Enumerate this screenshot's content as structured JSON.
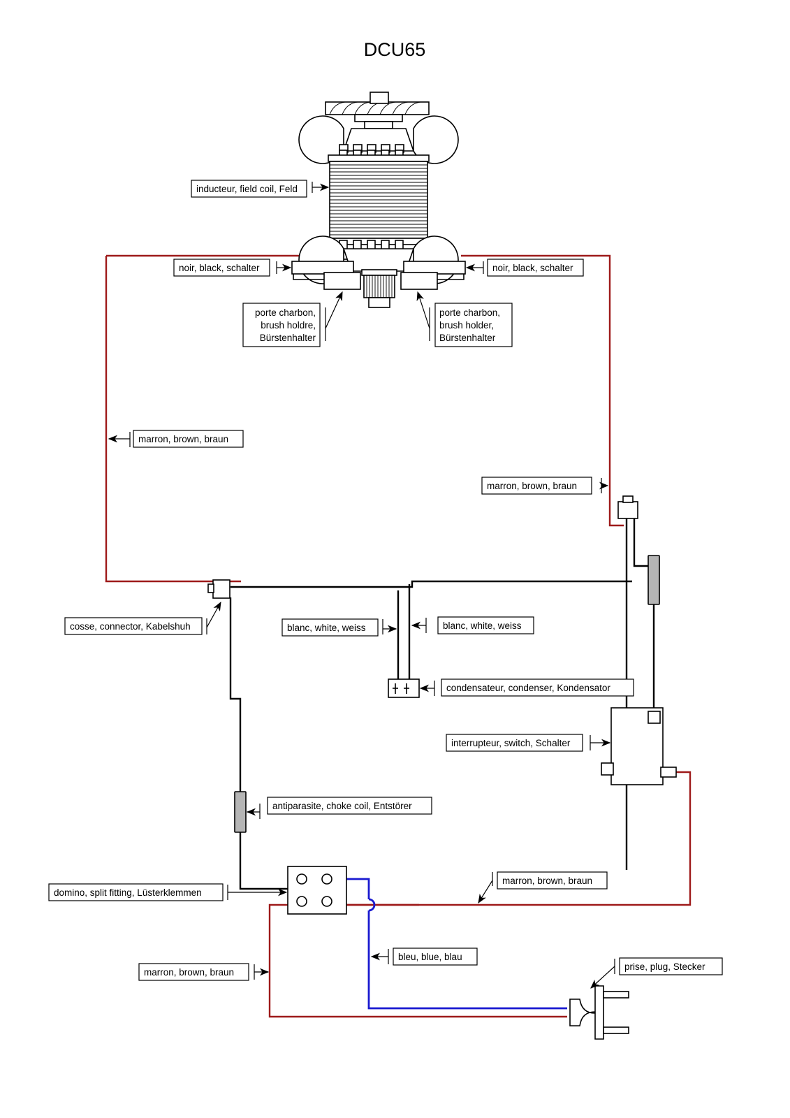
{
  "title": "DCU65",
  "labels": {
    "field_coil": "inducteur, field coil, Feld",
    "black_left": "noir, black, schalter",
    "black_right": "noir, black, schalter",
    "brush_left_line1": "porte charbon,",
    "brush_left_line2": "brush holdre,",
    "brush_left_line3": "Bürstenhalter",
    "brush_right_line1": "porte charbon,",
    "brush_right_line2": "brush holder,",
    "brush_right_line3": "Bürstenhalter",
    "brown_left": "marron, brown, braun",
    "brown_right": "marron, brown, braun",
    "connector": "cosse, connector, Kabelshuh",
    "white_left": "blanc, white, weiss",
    "white_right": "blanc, white, weiss",
    "condenser": "condensateur, condenser, Kondensator",
    "switch": "interrupteur, switch, Schalter",
    "choke": "antiparasite, choke coil, Entstörer",
    "domino": "domino, split fitting, Lüsterklemmen",
    "brown_mid": "marron, brown, braun",
    "brown_bottom": "marron, brown, braun",
    "blue": "bleu, blue, blau",
    "plug": "prise, plug, Stecker"
  },
  "colors": {
    "wire_brown": "#9e1a1a",
    "wire_blue": "#1a1ad0",
    "wire_black": "#000000",
    "part_gray": "#b5b5b5",
    "background": "#ffffff",
    "outline": "#000000"
  },
  "components": [
    "motor-field-coil",
    "brush-holder-left",
    "brush-holder-right",
    "cable-connector",
    "capacitor",
    "switch",
    "choke-coil-right",
    "choke-coil-left",
    "terminal-block",
    "mains-plug"
  ]
}
